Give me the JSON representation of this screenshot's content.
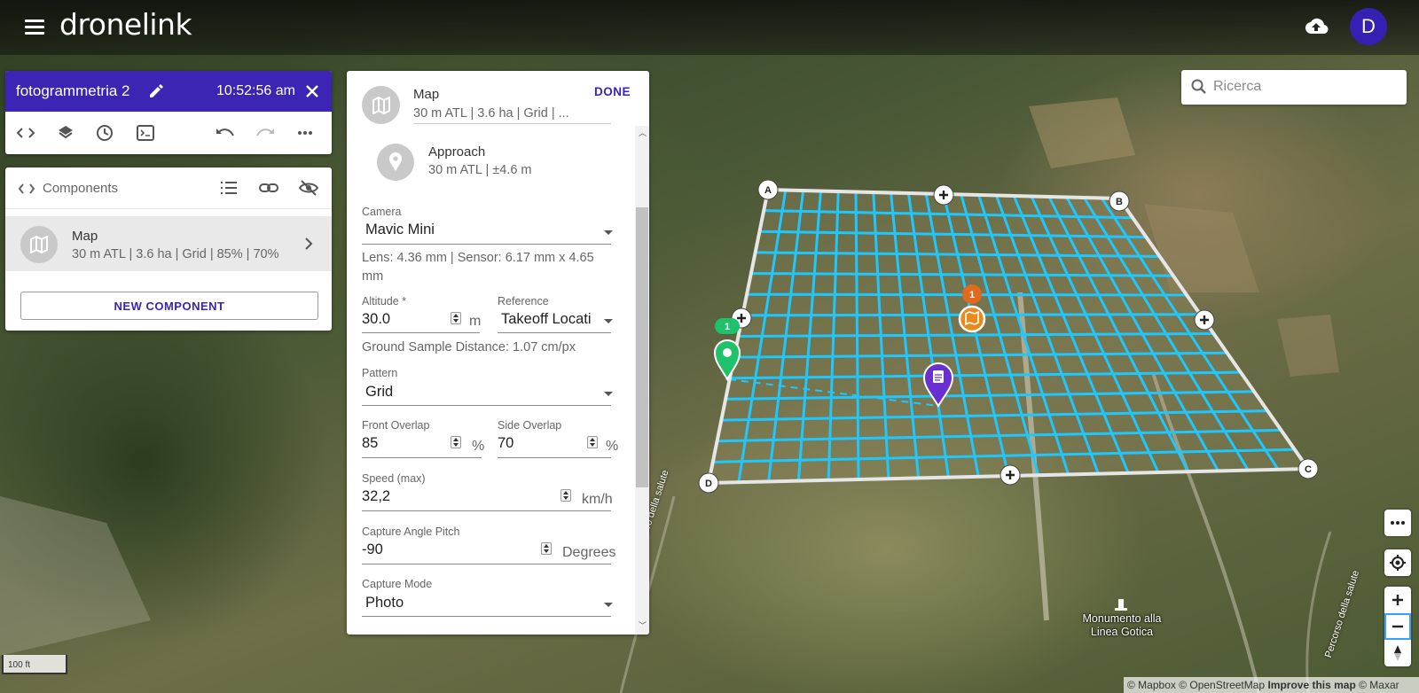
{
  "app": {
    "logo": "dronelink",
    "avatar_initial": "D",
    "accent": "#3c24b4"
  },
  "mission": {
    "title": "fotogrammetria 2",
    "time": "10:52:56 am",
    "tool_icons": [
      "code-icon",
      "layers-icon",
      "history-icon",
      "terminal-icon",
      "undo-icon",
      "redo-icon",
      "more-icon"
    ]
  },
  "components": {
    "title": "Components",
    "item": {
      "name": "Map",
      "summary": "30 m ATL | 3.6 ha | Grid | 85% | 70%"
    },
    "new_button": "NEW COMPONENT"
  },
  "editor": {
    "map_title": "Map",
    "map_summary": "30 m ATL | 3.6 ha | Grid | ...",
    "done_label": "DONE",
    "approach": {
      "title": "Approach",
      "summary": "30 m ATL | ±4.6 m"
    },
    "camera": {
      "label": "Camera",
      "value": "Mavic Mini"
    },
    "lens_info": "Lens: 4.36 mm | Sensor: 6.17 mm x 4.65",
    "lens_info_2": "mm",
    "altitude": {
      "label": "Altitude *",
      "value": "30.0",
      "unit": "m"
    },
    "reference": {
      "label": "Reference",
      "value": "Takeoff Locati"
    },
    "gsd_info": "Ground Sample Distance: 1.07 cm/px",
    "pattern": {
      "label": "Pattern",
      "value": "Grid"
    },
    "front_overlap": {
      "label": "Front Overlap",
      "value": "85",
      "unit": "%"
    },
    "side_overlap": {
      "label": "Side Overlap",
      "value": "70",
      "unit": "%"
    },
    "speed": {
      "label": "Speed (max)",
      "value": "32,2",
      "unit": "km/h"
    },
    "pitch": {
      "label": "Capture Angle Pitch",
      "value": "-90",
      "unit": "Degrees"
    },
    "capture_mode": {
      "label": "Capture Mode",
      "value": "Photo"
    }
  },
  "search": {
    "placeholder": "Ricerca"
  },
  "map": {
    "corners": [
      "A",
      "B",
      "C",
      "D"
    ],
    "marker_badges": {
      "takeoff": "1",
      "map": "1"
    },
    "road_label_left": "ero della salute",
    "road_label_right": "Percorso della salute",
    "poi_line_1": "Monumento alla",
    "poi_line_2": "Linea Gotica",
    "scale": "100 ft",
    "colors": {
      "grid": "#1ec8ff",
      "boundary": "#e6e6e6",
      "takeoff": "#1fc26b",
      "map_marker": "#e88a1e",
      "poi": "#6a2fd0"
    }
  },
  "attribution": {
    "text": "© Mapbox © OpenStreetMap ",
    "improve": "Improve this map",
    "maxar": " © Maxar"
  }
}
